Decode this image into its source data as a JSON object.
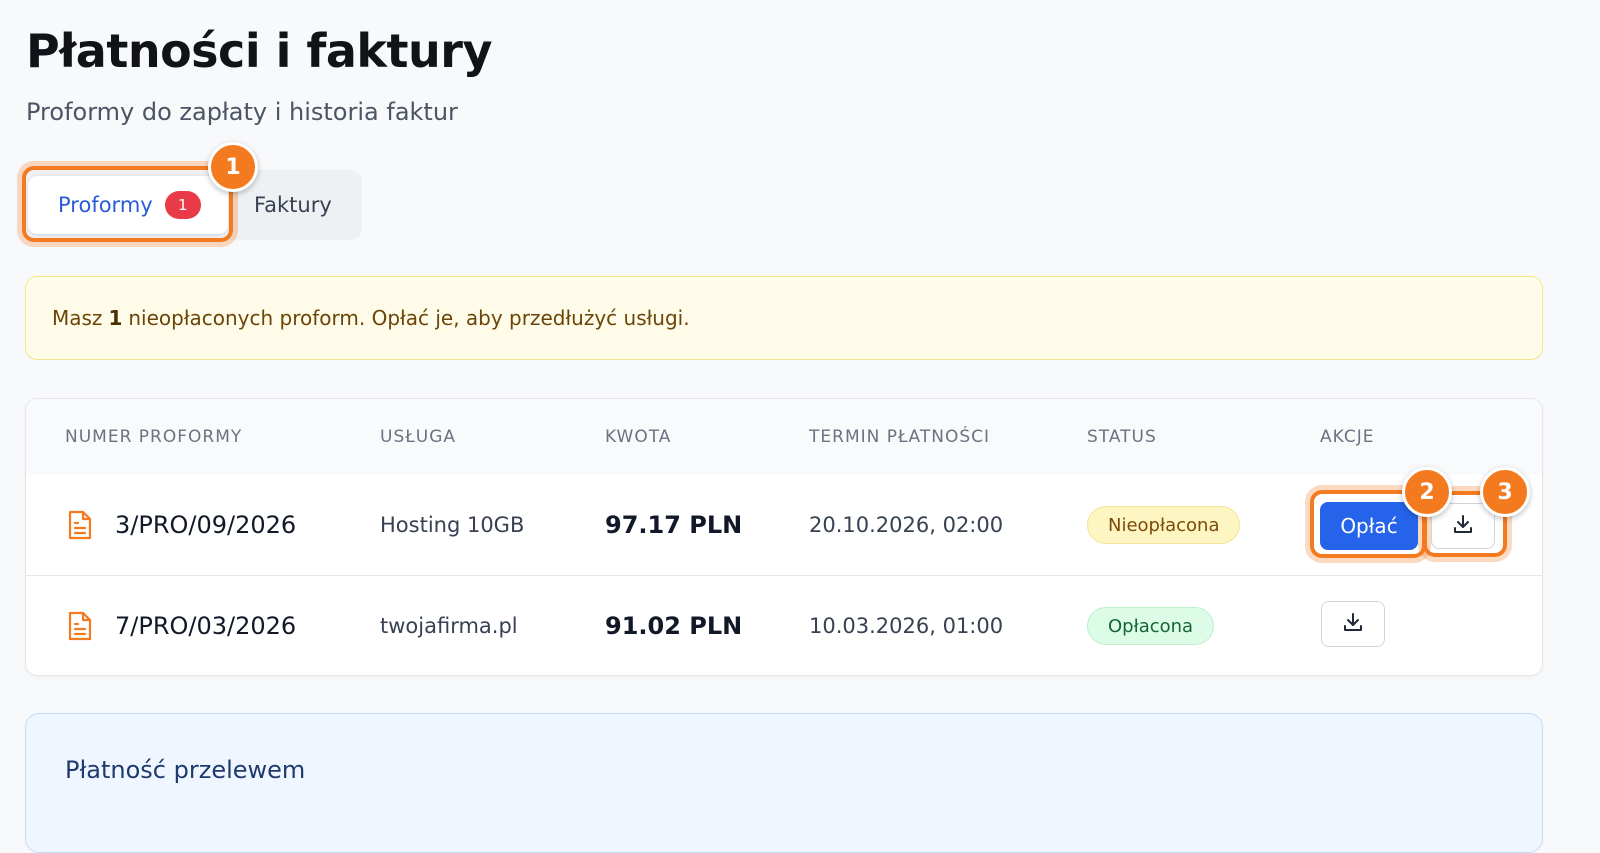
{
  "header": {
    "title": "Płatności i faktury",
    "subtitle": "Proformy do zapłaty i historia faktur"
  },
  "tabs": [
    {
      "label": "Proformy",
      "badge": "1",
      "active": true
    },
    {
      "label": "Faktury",
      "active": false
    }
  ],
  "notice": {
    "prefix": "Masz",
    "count": "1",
    "suffix": "nieopłaconych proform. Opłać je, aby przedłużyć usługi."
  },
  "table": {
    "columns": [
      "NUMER PROFORMY",
      "USŁUGA",
      "KWOTA",
      "TERMIN PŁATNOŚCI",
      "STATUS",
      "AKCJE"
    ],
    "rows": [
      {
        "number": "3/PRO/09/2026",
        "service": "Hosting 10GB",
        "amount": "97.17 PLN",
        "due": "20.10.2026, 02:00",
        "status": "Nieopłacona",
        "pay_label": "Opłać"
      },
      {
        "number": "7/PRO/03/2026",
        "service": "twojafirma.pl",
        "amount": "91.02 PLN",
        "due": "10.03.2026, 01:00",
        "status": "Opłacona"
      }
    ]
  },
  "bank_section": {
    "title": "Płatność przelewem"
  },
  "annotations": {
    "markers": [
      "1",
      "2",
      "3"
    ]
  },
  "colors": {
    "accent": "#2563eb",
    "highlight": "#f47a20",
    "badge": "#e83a47",
    "status_unpaid": "#fdf6c3",
    "status_paid": "#dcfce7"
  },
  "icons": {
    "document": "file-text-icon",
    "download": "download-icon"
  }
}
